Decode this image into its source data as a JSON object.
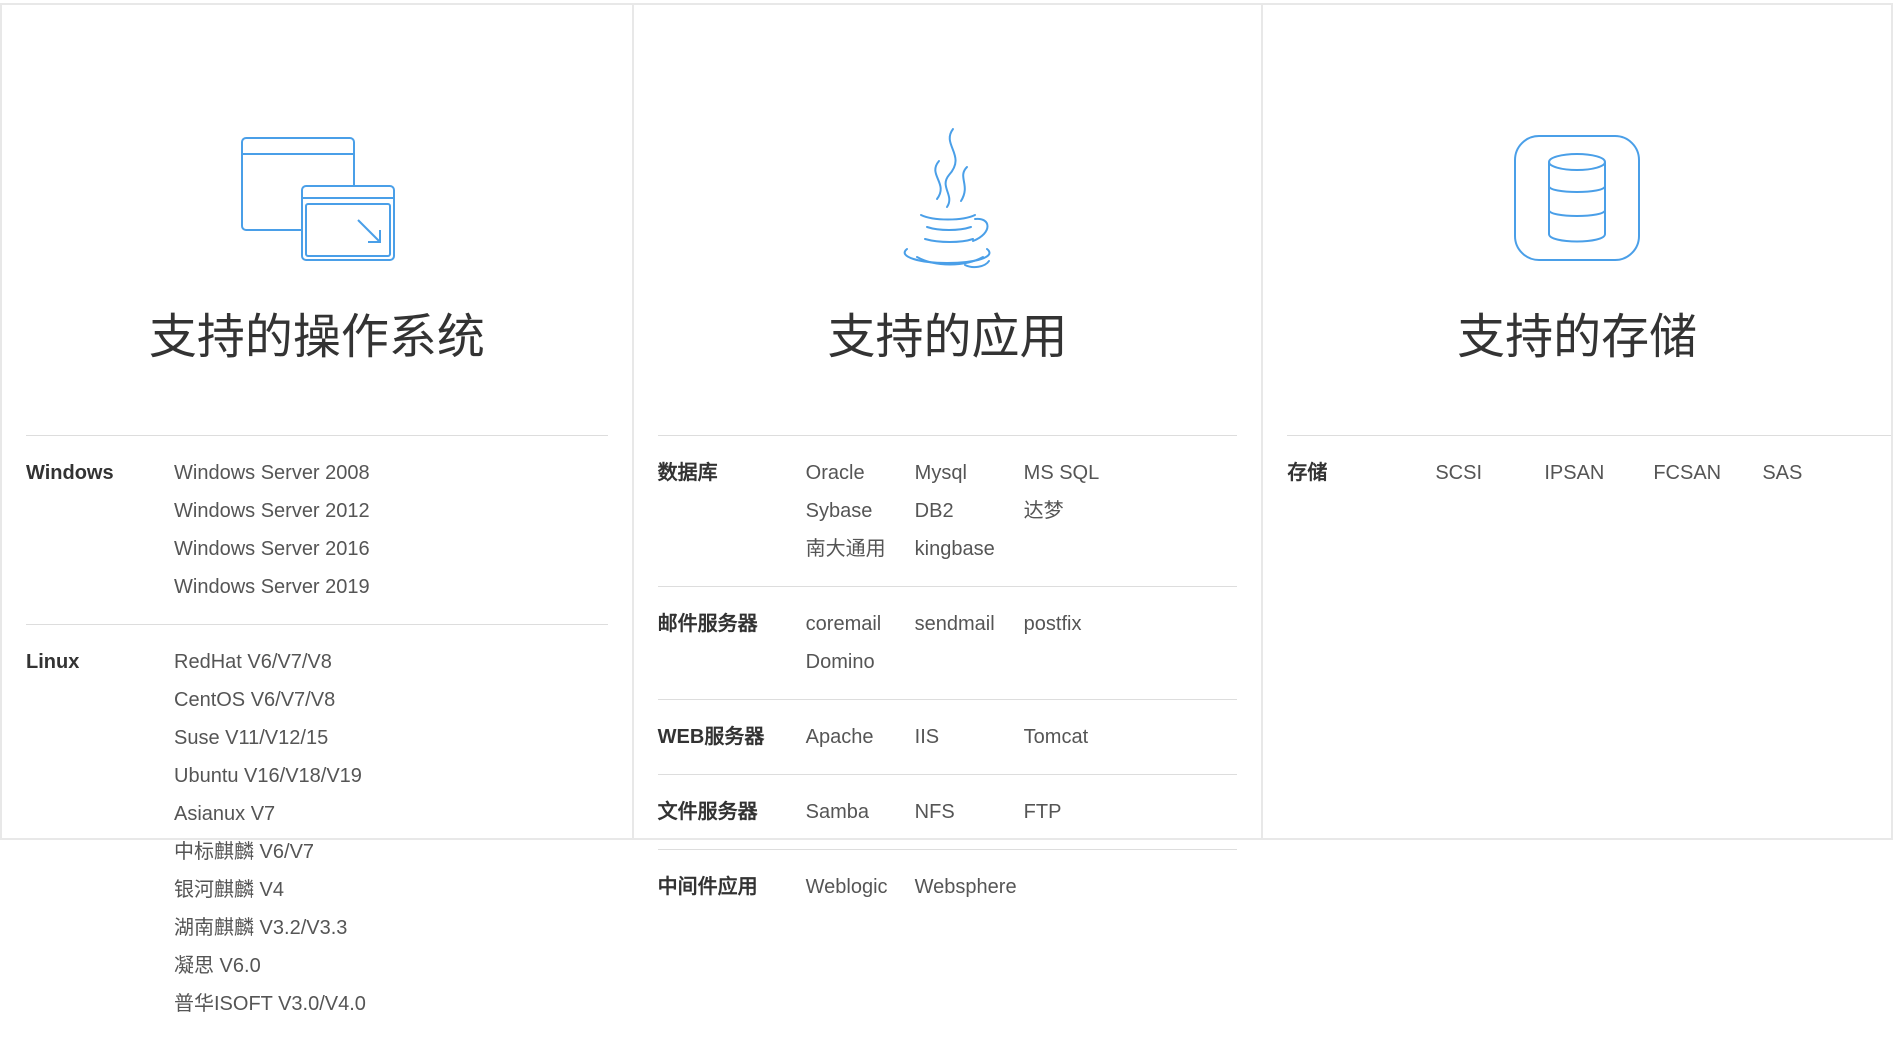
{
  "columns": {
    "os": {
      "title": "支持的操作系统",
      "icon": "window-resize-icon",
      "rows": [
        {
          "label": "Windows",
          "items": [
            "Windows Server 2008",
            "Windows Server 2012",
            "Windows Server 2016",
            "Windows Server 2019"
          ]
        },
        {
          "label": "Linux",
          "items": [
            "RedHat V6/V7/V8",
            "CentOS V6/V7/V8",
            "Suse V11/V12/15",
            "Ubuntu V16/V18/V19",
            "Asianux V7",
            "中标麒麟 V6/V7",
            "银河麒麟 V4",
            "湖南麒麟 V3.2/V3.3",
            "凝思 V6.0",
            "普华ISOFT V3.0/V4.0"
          ]
        }
      ]
    },
    "app": {
      "title": "支持的应用",
      "icon": "java-coffee-cup-icon",
      "rows": [
        {
          "label": "数据库",
          "items": [
            "Oracle",
            "Mysql",
            "MS SQL",
            "Sybase",
            "DB2",
            "达梦",
            "南大通用",
            "kingbase"
          ]
        },
        {
          "label": "邮件服务器",
          "items": [
            "coremail",
            "sendmail",
            "postfix",
            "Domino"
          ]
        },
        {
          "label": "WEB服务器",
          "items": [
            "Apache",
            "IIS",
            "Tomcat"
          ]
        },
        {
          "label": "文件服务器",
          "items": [
            "Samba",
            "NFS",
            "FTP"
          ]
        },
        {
          "label": "中间件应用",
          "items": [
            "Weblogic",
            "Websphere"
          ]
        }
      ]
    },
    "storage": {
      "title": "支持的存储",
      "icon": "database-storage-icon",
      "rows": [
        {
          "label": "存储",
          "items": [
            "SCSI",
            "IPSAN",
            "FCSAN",
            "SAS"
          ]
        }
      ]
    }
  },
  "colors": {
    "icon": "#4a9fe8",
    "divider": "#dddddd",
    "title": "#333333",
    "text": "#555555"
  }
}
